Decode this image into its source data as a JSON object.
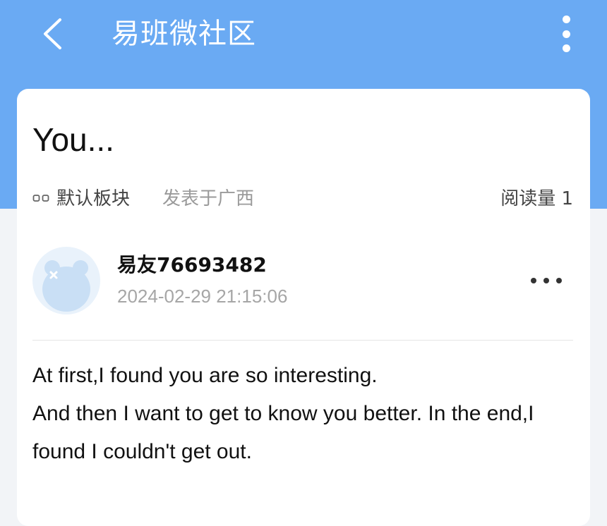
{
  "header": {
    "title": "易班微社区",
    "back_icon": "chevron-left-icon",
    "more_icon": "more-vertical-icon",
    "background_color": "#6aaaf3"
  },
  "post": {
    "title": "You...",
    "board": "默认板块",
    "location": "发表于广西",
    "read_count": "阅读量 1",
    "author": {
      "name": "易友76693482",
      "timestamp": "2024-02-29 21:15:06",
      "avatar_icon": "bear-avatar-icon"
    },
    "more_icon": "more-horizontal-icon",
    "body_lines": [
      "At first,I found you are so interesting.",
      "And then I want to get to know you better. In the end,I found I couldn't get out."
    ]
  }
}
